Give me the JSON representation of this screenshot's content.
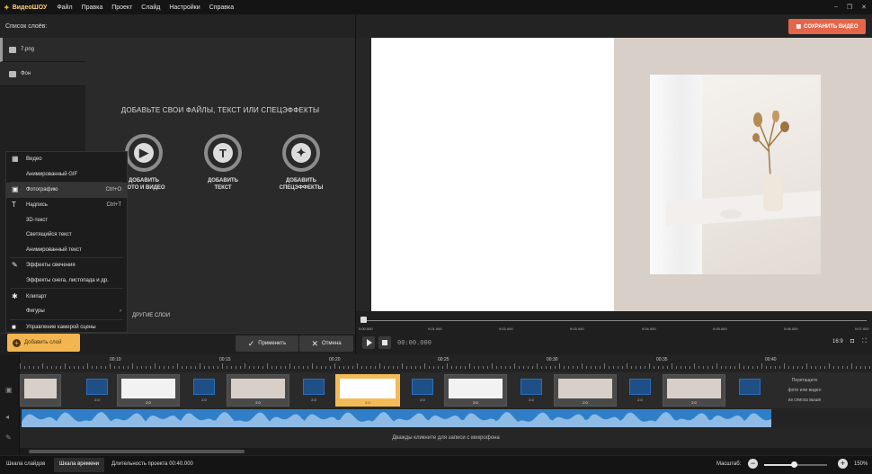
{
  "app": {
    "name": "ВидеоШОУ",
    "menu": [
      "Файл",
      "Правка",
      "Проект",
      "Слайд",
      "Настройки",
      "Справка"
    ],
    "window_controls": [
      "–",
      "❐",
      "✕"
    ]
  },
  "left_panel": {
    "header": "Список слоёв:",
    "slides": [
      {
        "label": "7.png"
      },
      {
        "label": "Фон"
      }
    ],
    "add_layer_button": "Добавить слой"
  },
  "editor": {
    "title": "ДОБАВЬТЕ СВОИ ФАЙЛЫ, ТЕКСТ ИЛИ СПЕЦЭФФЕКТЫ",
    "buttons": [
      {
        "line1": "ДОБАВИТЬ",
        "line2": "ФОТО И ВИДЕО",
        "glyph": "▶"
      },
      {
        "line1": "ДОБАВИТЬ",
        "line2": "ТЕКСТ",
        "glyph": "T"
      },
      {
        "line1": "ДОБАВИТЬ",
        "line2": "СПЕЦЭФФЕКТЫ",
        "glyph": "✦"
      }
    ],
    "other_layers": "ДРУГИЕ СЛОИ",
    "apply_button": "Применить",
    "cancel_button": "Отмена"
  },
  "context_menu": {
    "items": [
      {
        "label": "Видео",
        "shortcut": "",
        "icon": "film-icon"
      },
      {
        "label": "Анимированный GIF",
        "shortcut": "",
        "icon": ""
      },
      {
        "label": "Фотографию",
        "shortcut": "Ctrl+O",
        "icon": "image-icon",
        "highlight": true
      },
      {
        "label": "Надпись",
        "shortcut": "Ctrl+T",
        "icon": "text-icon"
      },
      {
        "label": "3D-текст",
        "shortcut": "",
        "icon": ""
      },
      {
        "label": "Светящийся текст",
        "shortcut": "",
        "icon": ""
      },
      {
        "label": "Анимированный текст",
        "shortcut": "",
        "icon": ""
      },
      {
        "label": "Эффекты свечения",
        "shortcut": "",
        "icon": "magic-wand-icon"
      },
      {
        "label": "Эффекты снега, листопада и др.",
        "shortcut": "",
        "icon": ""
      },
      {
        "label": "Клипарт",
        "shortcut": "",
        "icon": "gear-icon"
      },
      {
        "label": "Фигуры",
        "shortcut": "›",
        "icon": ""
      },
      {
        "label": "Управление камерой сцены",
        "shortcut": "",
        "icon": "camera-icon"
      }
    ]
  },
  "preview": {
    "save_button": "СОХРАНИТЬ ВИДЕО",
    "scrub_ticks": [
      "0:00.000",
      "0:01.000",
      "0:02.000",
      "0:03.000",
      "0:04.000",
      "0:05.000",
      "0:06.000",
      "0:07.000"
    ],
    "timecode": "00:00.000",
    "aspect_ratio": "16:9"
  },
  "timeline": {
    "ruler_labels": [
      "00:10",
      "00:15",
      "00:20",
      "00:25",
      "00:30",
      "00:35",
      "00:40"
    ],
    "clip_duration": "2.0",
    "transition_hint": [
      "Перетащите",
      "фото или видео",
      "из списка выше"
    ],
    "mic_hint": "Дважды кликните для записи с микрофона"
  },
  "statusbar": {
    "tab_slides": "Шкала слайдов",
    "tab_timeline": "Шкала времени",
    "duration": "Длительность проекта 00:40.000",
    "zoom_label": "Масштаб:",
    "zoom_value": "150%",
    "zoom_fraction": 0.47
  },
  "colors": {
    "accent_orange": "#f2b54f",
    "save_red": "#e4664a",
    "audio_blue": "#2f7fc8"
  }
}
